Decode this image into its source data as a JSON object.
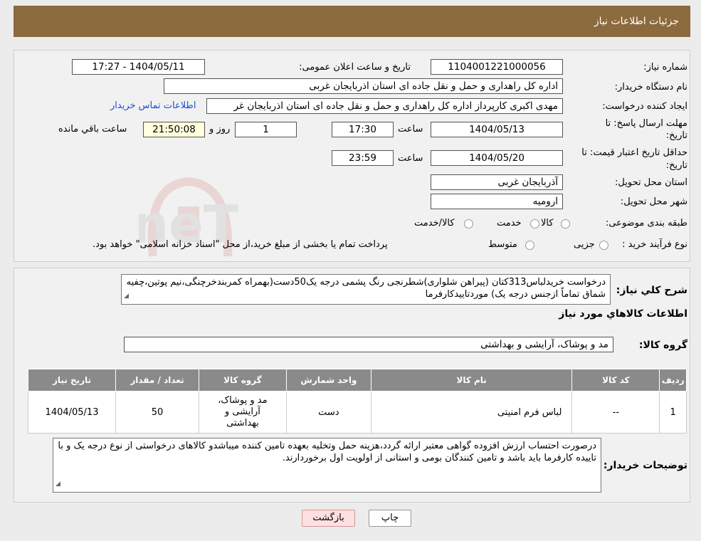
{
  "header": {
    "title": "جزئیات اطلاعات نیاز"
  },
  "form": {
    "need_number_label": "شماره نیاز:",
    "need_number": "1104001221000056",
    "announce_label": "تاریخ و ساعت اعلان عمومی:",
    "announce_value": "1404/05/11 - 17:27",
    "buyer_org_label": "نام دستگاه خریدار:",
    "buyer_org": "اداره کل راهداری و حمل و نقل جاده ای استان اذربایجان غربی",
    "requester_label": "ایجاد کننده درخواست:",
    "requester": "مهدی اکبری کارپرداز اداره کل راهداری و حمل و نقل جاده ای استان اذربایجان غر",
    "contact_link": "اطلاعات تماس خریدار",
    "reply_deadline_label_1": "مهلت ارسال پاسخ: تا",
    "reply_deadline_label_2": "تاریخ:",
    "reply_date": "1404/05/13",
    "time_label": "ساعت",
    "reply_time": "17:30",
    "days_value": "1",
    "days_label": "روز و",
    "remaining_value": "21:50:08",
    "remaining_label": "ساعت باقي مانده",
    "price_validity_label_1": "حداقل تاریخ اعتبار قیمت: تا",
    "price_validity_label_2": "تاریخ:",
    "price_date": "1404/05/20",
    "price_time_label": "ساعت",
    "price_time": "23:59",
    "province_label": "استان محل تحویل:",
    "province": "آذربایجان غربی",
    "city_label": "شهر محل تحویل:",
    "city": "ارومیه",
    "category_label": "طبقه بندی موضوعی:",
    "category_options": [
      "کالا",
      "خدمت",
      "کالا/خدمت"
    ],
    "process_label": "نوع فرآیند خرید :",
    "process_options": [
      "جزیی",
      "متوسط"
    ],
    "process_note": "پرداخت تمام یا بخشی از مبلغ خرید،از محل \"اسناد خزانه اسلامی\" خواهد بود."
  },
  "description": {
    "label": "شرح کلي نياز:",
    "text": "درخواست خریدلباس313کتان (پیراهن شلواری)شطرنجی رنگ پشمی درجه یک50دست(بهمراه کمربندخرچنگی،نیم پوتین،چفیه شماق تماماً ازجنس درجه یک) موردتاییدکارفرما"
  },
  "goods_section": {
    "title": "اطلاعات کالاهاي مورد نياز",
    "group_label": "گروه کالا:",
    "group_value": "مد و پوشاک، آرایشی و بهداشتی"
  },
  "table": {
    "headers": [
      "رديف",
      "کد کالا",
      "نام کالا",
      "واحد شمارش",
      "گروه کالا",
      "تعداد / مقدار",
      "تاريخ نياز"
    ],
    "rows": [
      [
        "1",
        "--",
        "لباس فرم امنیتی",
        "دست",
        "مد و پوشاک، آرایشی و بهداشتی",
        "50",
        "1404/05/13"
      ]
    ]
  },
  "notes": {
    "label": "توضیحات خریدار:",
    "text": "درصورت احتساب ارزش افزوده گواهی معتبر ارائه گردد،هزینه حمل وتخلیه بعهده تامین کننده میباشدو کالاهای درخواستی از نوع درجه یک و با تاییده کارفرما باید باشد و تامین کنندگان بومی و استانی از اولویت اول برخوردارند."
  },
  "buttons": {
    "print": "چاپ",
    "back": "بازگشت"
  },
  "watermark": {
    "text": "AriaTender.neT"
  },
  "colors": {
    "header_bg": "#8b6a3e",
    "table_header": "#8a8a8a",
    "link": "#1a4fd6",
    "back_btn": "#ffe0e0"
  }
}
